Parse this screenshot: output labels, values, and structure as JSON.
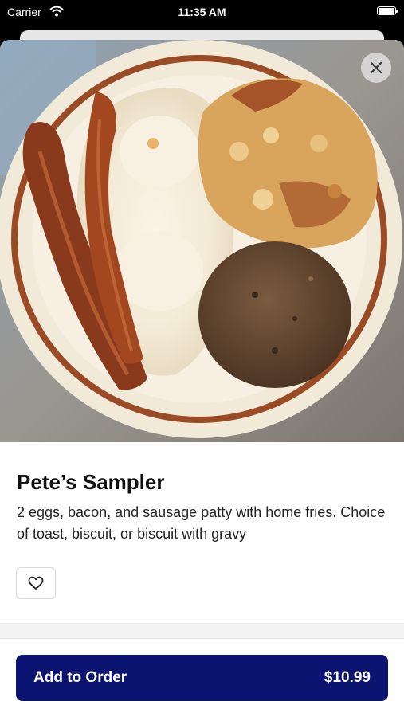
{
  "status_bar": {
    "carrier": "Carrier",
    "time": "11:35 AM"
  },
  "item": {
    "title": "Pete’s Sampler",
    "description": "2 eggs, bacon, and sausage patty with home fries. Choice of toast, biscuit, or biscuit with gravy",
    "image_alt": "Pete’s Sampler plate"
  },
  "actions": {
    "add_label": "Add to Order",
    "price": "$10.99"
  },
  "icons": {
    "close": "close-icon",
    "favorite": "heart-icon",
    "wifi": "wifi-icon",
    "battery": "battery-icon"
  },
  "colors": {
    "accent": "#0b1470"
  }
}
